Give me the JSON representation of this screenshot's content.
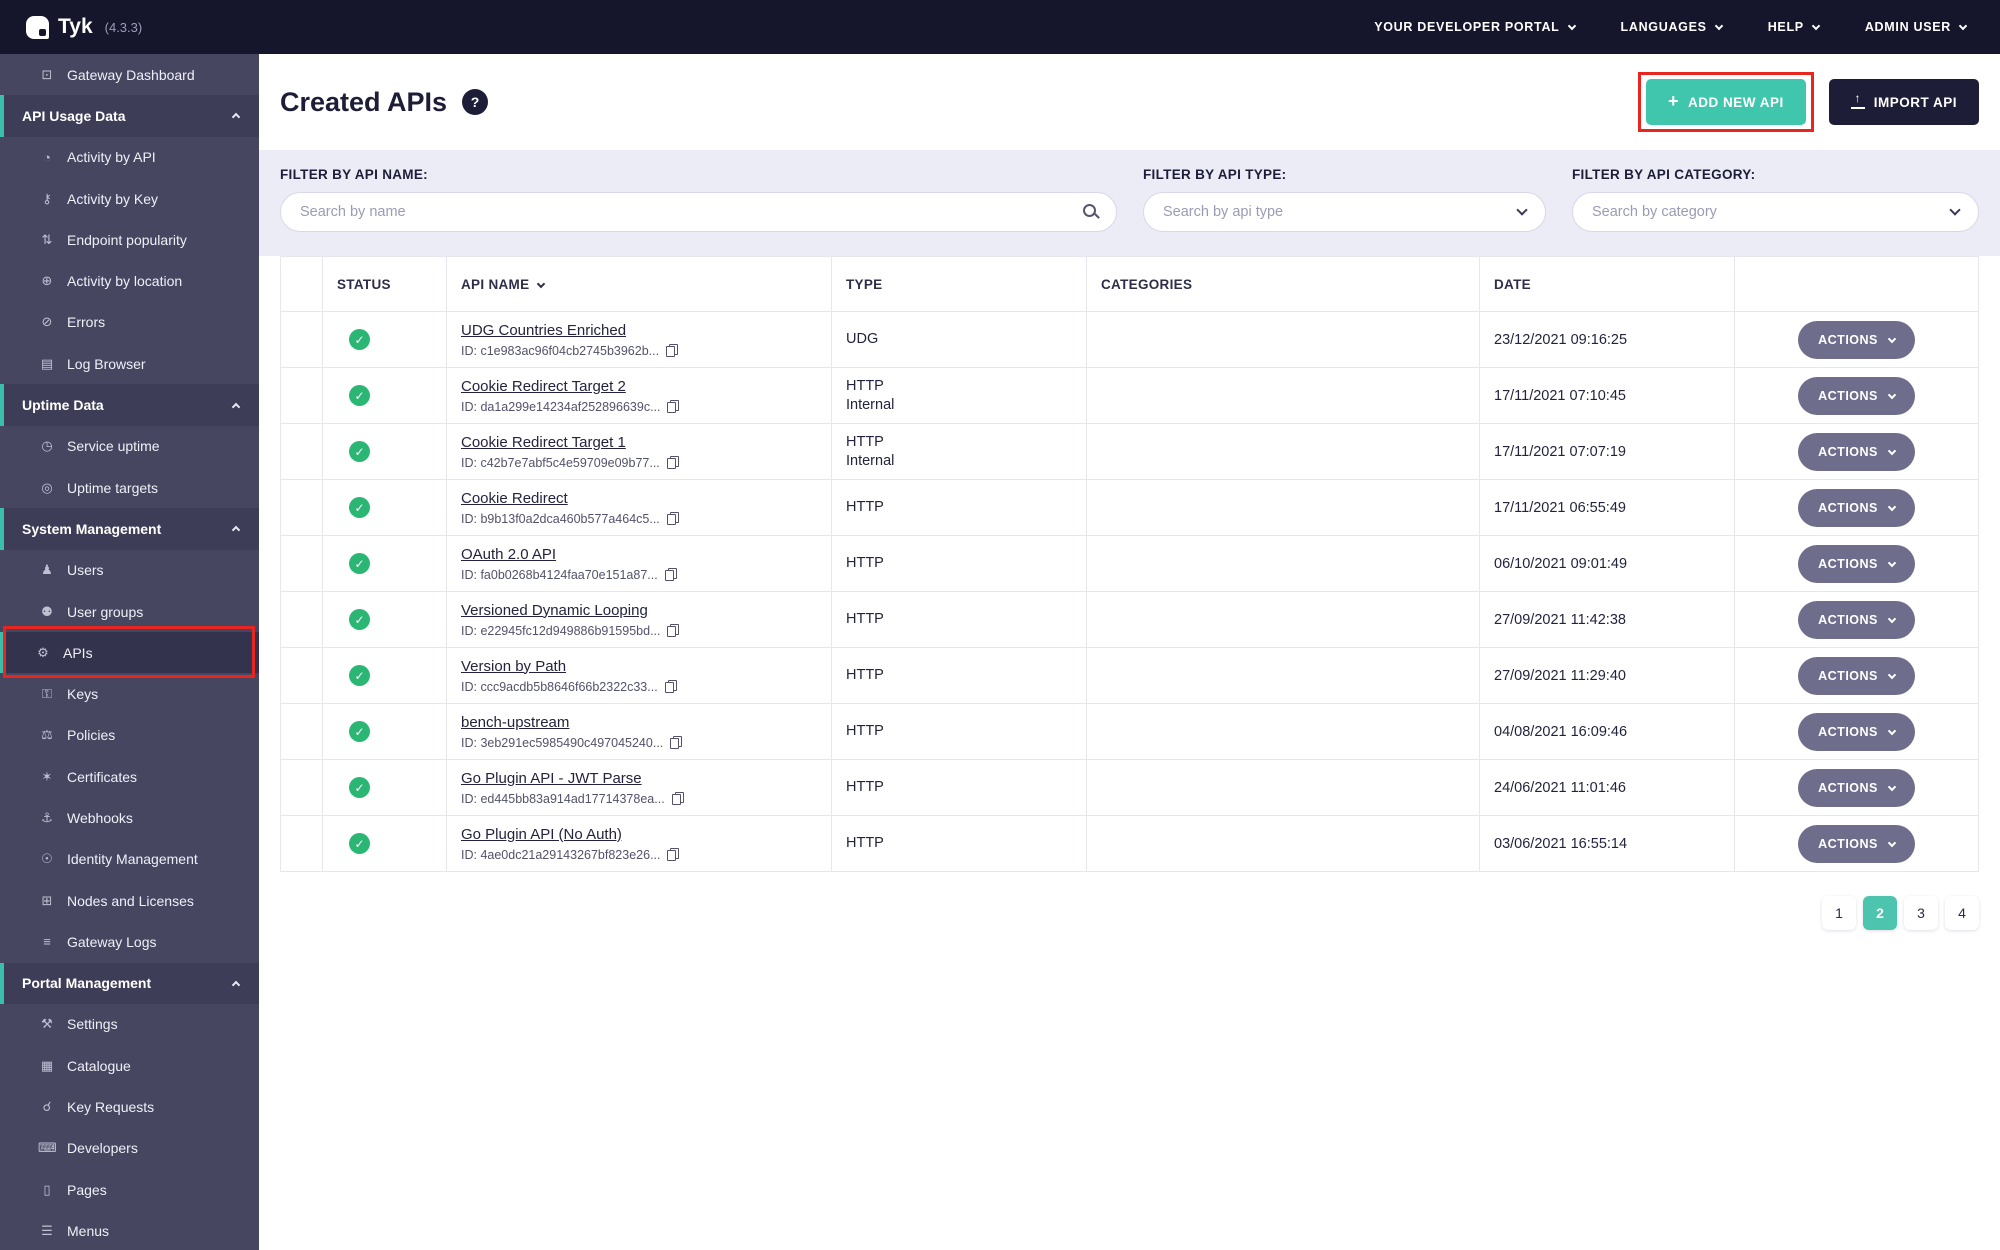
{
  "colors": {
    "accent_teal": "#3FC6AD",
    "topbar_bg": "#15152B",
    "sidebar_bg": "#464660",
    "status_green": "#2BB673",
    "annotation_red": "#E8251F",
    "actions_gray": "#6E6E8C",
    "filter_band": "#ECECF6",
    "pagination_active": "#4CC4AE"
  },
  "topbar": {
    "logo_text": "Tyk",
    "version": "(4.3.3)",
    "menus": [
      {
        "label": "YOUR DEVELOPER PORTAL"
      },
      {
        "label": "LANGUAGES"
      },
      {
        "label": "HELP"
      },
      {
        "label": "ADMIN USER"
      }
    ]
  },
  "sidebar": {
    "items": [
      {
        "label": "Gateway Dashboard",
        "kind": "item",
        "icon": "monitor-icon",
        "glyph": "⊡"
      },
      {
        "label": "API Usage Data",
        "kind": "section"
      },
      {
        "label": "Activity by API",
        "kind": "item",
        "icon": "activity-api-icon",
        "glyph": "◔"
      },
      {
        "label": "Activity by Key",
        "kind": "item",
        "icon": "activity-key-icon",
        "glyph": "⚷"
      },
      {
        "label": "Endpoint popularity",
        "kind": "item",
        "icon": "endpoint-popularity-icon",
        "glyph": "⇅"
      },
      {
        "label": "Activity by location",
        "kind": "item",
        "icon": "location-icon",
        "glyph": "⊕"
      },
      {
        "label": "Errors",
        "kind": "item",
        "icon": "errors-icon",
        "glyph": "⊘"
      },
      {
        "label": "Log Browser",
        "kind": "item",
        "icon": "log-browser-icon",
        "glyph": "▤"
      },
      {
        "label": "Uptime Data",
        "kind": "section"
      },
      {
        "label": "Service uptime",
        "kind": "item",
        "icon": "service-uptime-icon",
        "glyph": "◷"
      },
      {
        "label": "Uptime targets",
        "kind": "item",
        "icon": "uptime-targets-icon",
        "glyph": "◎"
      },
      {
        "label": "System Management",
        "kind": "section"
      },
      {
        "label": "Users",
        "kind": "item",
        "icon": "user-icon",
        "glyph": "♟"
      },
      {
        "label": "User groups",
        "kind": "item",
        "icon": "user-groups-icon",
        "glyph": "⚉"
      },
      {
        "label": "APIs",
        "kind": "item",
        "icon": "apis-gear-icon",
        "glyph": "⚙",
        "active": true
      },
      {
        "label": "Keys",
        "kind": "item",
        "icon": "keys-icon",
        "glyph": "⚿"
      },
      {
        "label": "Policies",
        "kind": "item",
        "icon": "policies-icon",
        "glyph": "⚖"
      },
      {
        "label": "Certificates",
        "kind": "item",
        "icon": "certificates-icon",
        "glyph": "✶"
      },
      {
        "label": "Webhooks",
        "kind": "item",
        "icon": "webhooks-icon",
        "glyph": "⚓"
      },
      {
        "label": "Identity Management",
        "kind": "item",
        "icon": "identity-icon",
        "glyph": "☉"
      },
      {
        "label": "Nodes and Licenses",
        "kind": "item",
        "icon": "nodes-licenses-icon",
        "glyph": "⊞"
      },
      {
        "label": "Gateway Logs",
        "kind": "item",
        "icon": "gateway-logs-icon",
        "glyph": "≡"
      },
      {
        "label": "Portal Management",
        "kind": "section"
      },
      {
        "label": "Settings",
        "kind": "item",
        "icon": "settings-wrench-icon",
        "glyph": "⚒"
      },
      {
        "label": "Catalogue",
        "kind": "item",
        "icon": "catalogue-icon",
        "glyph": "▦"
      },
      {
        "label": "Key Requests",
        "kind": "item",
        "icon": "key-requests-icon",
        "glyph": "☌"
      },
      {
        "label": "Developers",
        "kind": "item",
        "icon": "developers-icon",
        "glyph": "⌨"
      },
      {
        "label": "Pages",
        "kind": "item",
        "icon": "pages-icon",
        "glyph": "▯"
      },
      {
        "label": "Menus",
        "kind": "item",
        "icon": "menus-icon",
        "glyph": "☰"
      }
    ]
  },
  "page": {
    "title": "Created APIs",
    "add_button": "ADD NEW API",
    "import_button": "IMPORT API"
  },
  "icons": {
    "help": "?",
    "plus": "+",
    "upload_arrow": "↑"
  },
  "filters": {
    "name": {
      "label": "FILTER BY API NAME:",
      "placeholder": "Search by name"
    },
    "type": {
      "label": "FILTER BY API TYPE:",
      "placeholder": "Search by api type"
    },
    "category": {
      "label": "FILTER BY API CATEGORY:",
      "placeholder": "Search by category"
    }
  },
  "table": {
    "headers": {
      "status": "STATUS",
      "api_name": "API NAME",
      "type": "TYPE",
      "categories": "CATEGORIES",
      "date": "DATE"
    },
    "actions_label": "ACTIONS",
    "status_ok_glyph": "✓",
    "rows": [
      {
        "name": "UDG Countries Enriched",
        "id": "ID: c1e983ac96f04cb2745b3962b...",
        "type": [
          "UDG"
        ],
        "categories": "",
        "date": "23/12/2021 09:16:25"
      },
      {
        "name": "Cookie Redirect Target 2",
        "id": "ID: da1a299e14234af252896639c...",
        "type": [
          "HTTP",
          "Internal"
        ],
        "categories": "",
        "date": "17/11/2021 07:10:45"
      },
      {
        "name": "Cookie Redirect Target 1",
        "id": "ID: c42b7e7abf5c4e59709e09b77...",
        "type": [
          "HTTP",
          "Internal"
        ],
        "categories": "",
        "date": "17/11/2021 07:07:19"
      },
      {
        "name": "Cookie Redirect",
        "id": "ID: b9b13f0a2dca460b577a464c5...",
        "type": [
          "HTTP"
        ],
        "categories": "",
        "date": "17/11/2021 06:55:49"
      },
      {
        "name": "OAuth 2.0 API",
        "id": "ID: fa0b0268b4124faa70e151a87...",
        "type": [
          "HTTP"
        ],
        "categories": "",
        "date": "06/10/2021 09:01:49"
      },
      {
        "name": "Versioned Dynamic Looping",
        "id": "ID: e22945fc12d949886b91595bd...",
        "type": [
          "HTTP"
        ],
        "categories": "",
        "date": "27/09/2021 11:42:38"
      },
      {
        "name": "Version by Path",
        "id": "ID: ccc9acdb5b8646f66b2322c33...",
        "type": [
          "HTTP"
        ],
        "categories": "",
        "date": "27/09/2021 11:29:40"
      },
      {
        "name": "bench-upstream",
        "id": "ID: 3eb291ec5985490c497045240...",
        "type": [
          "HTTP"
        ],
        "categories": "",
        "date": "04/08/2021 16:09:46"
      },
      {
        "name": "Go Plugin API - JWT Parse",
        "id": "ID: ed445bb83a914ad17714378ea...",
        "type": [
          "HTTP"
        ],
        "categories": "",
        "date": "24/06/2021 11:01:46"
      },
      {
        "name": "Go Plugin API (No Auth)",
        "id": "ID: 4ae0dc21a29143267bf823e26...",
        "type": [
          "HTTP"
        ],
        "categories": "",
        "date": "03/06/2021 16:55:14"
      }
    ]
  },
  "pagination": {
    "pages": [
      "1",
      "2",
      "3",
      "4"
    ],
    "active": "2"
  }
}
